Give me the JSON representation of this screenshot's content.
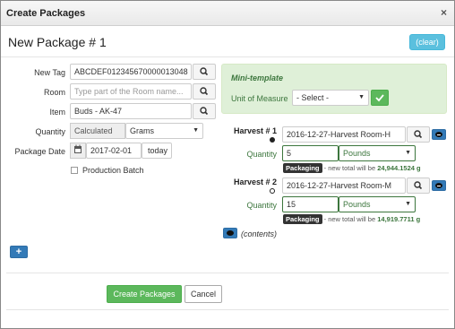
{
  "dialog": {
    "title": "Create Packages",
    "close": "×"
  },
  "header": {
    "title": "New Package # 1",
    "clear_label": "(clear)"
  },
  "form": {
    "new_tag": {
      "label": "New Tag",
      "value": "ABCDEF012345670000013048"
    },
    "room": {
      "label": "Room",
      "placeholder": "Type part of the Room name..."
    },
    "item": {
      "label": "Item",
      "value": "Buds - AK-47"
    },
    "quantity": {
      "label": "Quantity",
      "calc_label": "Calculated",
      "unit": "Grams"
    },
    "package_date": {
      "label": "Package Date",
      "value": "2017-02-01",
      "today_label": "today"
    },
    "production_batch": {
      "label": "Production Batch",
      "checked": false
    }
  },
  "mini_template": {
    "title": "Mini-template",
    "uom_label": "Unit of Measure",
    "uom_value": "- Select -"
  },
  "harvests": [
    {
      "label": "Harvest # 1",
      "selected": true,
      "name": "2016-12-27-Harvest Room-H",
      "quantity_label": "Quantity",
      "quantity": "5",
      "unit": "Pounds",
      "badge": "Packaging",
      "note_prefix": "- new total will be",
      "new_total": "24,944.1524 g"
    },
    {
      "label": "Harvest # 2",
      "selected": false,
      "name": "2016-12-27-Harvest Room-M",
      "quantity_label": "Quantity",
      "quantity": "15",
      "unit": "Pounds",
      "badge": "Packaging",
      "note_prefix": "- new total will be",
      "new_total": "14,919.7711 g"
    }
  ],
  "contents_label": "(contents)",
  "footer": {
    "create_label": "Create Packages",
    "cancel_label": "Cancel"
  },
  "colors": {
    "primary": "#337ab7",
    "success": "#5cb85c",
    "info": "#5bc0de",
    "mini_bg": "#dff0d8",
    "green_text": "#3c763d"
  }
}
